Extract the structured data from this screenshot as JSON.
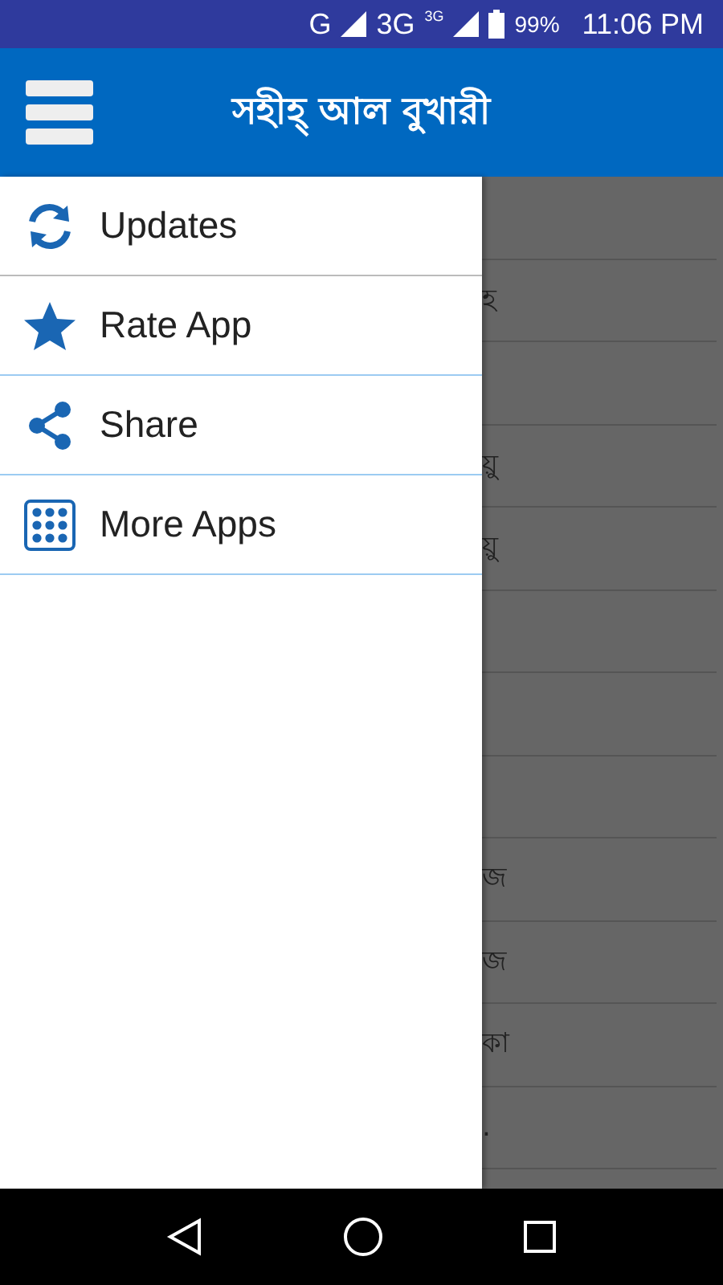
{
  "status_bar": {
    "network": "G",
    "network_2": "3G",
    "network_2_sup": "3G",
    "battery": "99%",
    "time": "11:06 PM"
  },
  "app_bar": {
    "title": "সহীহ্ আল বুখারী"
  },
  "drawer": {
    "items": [
      {
        "label": "Updates",
        "kind": "updates"
      },
      {
        "label": "Rate App",
        "kind": "rate"
      },
      {
        "label": "Share",
        "kind": "share"
      },
      {
        "label": "More Apps",
        "kind": "apps"
      }
    ]
  },
  "background_list": {
    "rows": [
      "",
      "হ",
      "",
      "য়ু",
      "য়ু",
      "",
      "",
      "",
      "জ",
      "জ",
      "কা",
      "."
    ]
  }
}
